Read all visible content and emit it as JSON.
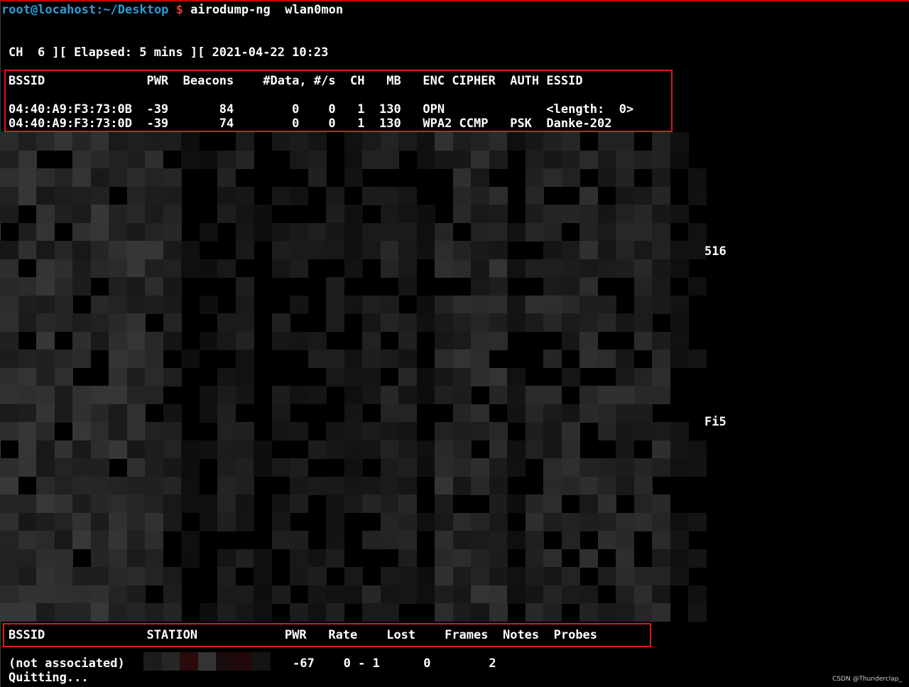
{
  "terminal": {
    "prompt_user_host": "root@locahost",
    "prompt_path": ":~/Desktop",
    "prompt_symbol": "$",
    "command": "airodump-ng  wlan0mon"
  },
  "status_line": "CH  6 ][ Elapsed: 5 mins ][ 2021-04-22 10:23",
  "ap_table": {
    "header": "BSSID              PWR  Beacons    #Data, #/s  CH   MB   ENC CIPHER  AUTH ESSID",
    "rows": [
      "04:40:A9:F3:73:0B  -39       84        0    0   1  130   OPN              <length:  0>",
      "04:40:A9:F3:73:0D  -39       74        0    0   1  130   WPA2 CCMP   PSK  Danke-202"
    ],
    "stray_fragments": [
      "516",
      "Fi5"
    ]
  },
  "station_table": {
    "header": "BSSID              STATION            PWR   Rate    Lost    Frames  Notes  Probes",
    "row_bssid": "(not associated)",
    "row_rest": "-67    0 - 1      0        2"
  },
  "quitting": "Quitting...",
  "watermark": "CSDN @Thunderclap_",
  "colors": {
    "background": "#000000",
    "text": "#ffffff",
    "prompt": "#2e9bd6",
    "prompt_symbol": "#e03c3c",
    "highlight_box": "#e01818"
  }
}
